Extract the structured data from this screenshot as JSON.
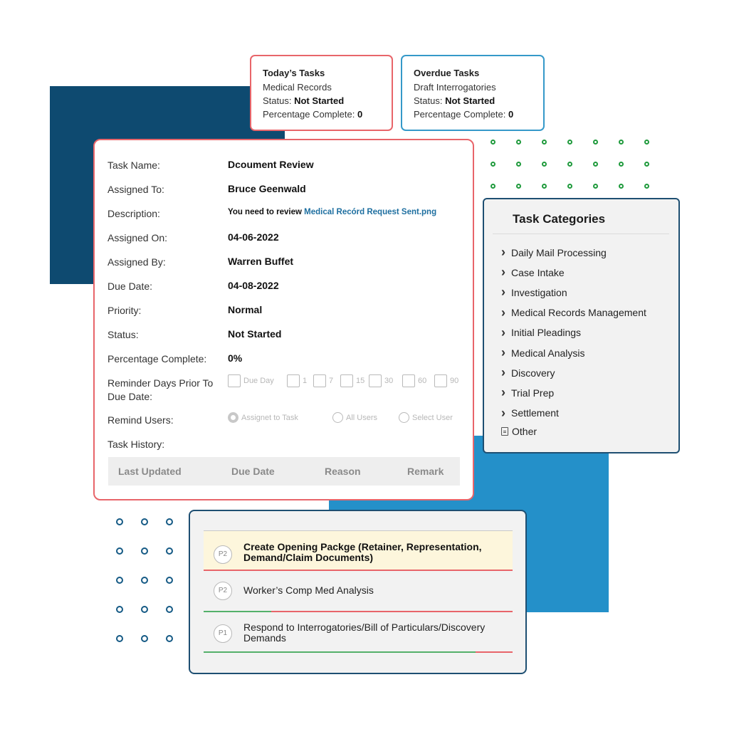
{
  "today": {
    "title": "Today’s Tasks",
    "task": "Medical Records",
    "status_label": "Status:",
    "status": "Not Started",
    "pct_label": "Percentage Complete:",
    "pct": "0"
  },
  "overdue": {
    "title": "Overdue Tasks",
    "task": "Draft Interrogatories",
    "status_label": "Status:",
    "status": "Not Started",
    "pct_label": "Percentage Complete:",
    "pct": "0"
  },
  "detail": {
    "task_name_label": "Task Name:",
    "task_name": "Dcoument Review",
    "assigned_to_label": "Assigned To:",
    "assigned_to": "Bruce Geenwald",
    "description_label": "Description:",
    "description_text": "You need to review",
    "description_link": "Medical Recórd Request Sent.png",
    "assigned_on_label": "Assigned On:",
    "assigned_on": "04-06-2022",
    "assigned_by_label": "Assigned By:",
    "assigned_by": "Warren Buffet",
    "due_date_label": "Due Date:",
    "due_date": "04-08-2022",
    "priority_label": "Priority:",
    "priority": "Normal",
    "status_label": "Status:",
    "status": "Not Started",
    "pct_label": "Percentage Complete:",
    "pct": "0%",
    "reminder_label": "Reminder Days Prior To Due Date:",
    "reminder_options": [
      "Due Day",
      "1",
      "7",
      "15",
      "30",
      "60",
      "90"
    ],
    "remind_users_label": "Remind Users:",
    "remind_options": [
      "Assignet to Task",
      "All Users",
      "Select User"
    ],
    "history_label": "Task History:",
    "history_headers": [
      "Last Updated",
      "Due Date",
      "Reason",
      "Remark"
    ]
  },
  "categories": {
    "title": "Task Categories",
    "items": [
      "Daily Mail Processing",
      "Case Intake",
      "Investigation",
      "Medical Records Management",
      "Initial Pleadings",
      "Medical Analysis",
      "Discovery",
      "Trial Prep",
      "Settlement",
      "Other"
    ]
  },
  "tasks": [
    {
      "priority": "P2",
      "text": "Create Opening Packge (Retainer, Representation, Demand/Claim Documents)",
      "progress": 0
    },
    {
      "priority": "P2",
      "text": "Worker’s Comp Med Analysis",
      "progress": 0.22
    },
    {
      "priority": "P1",
      "text": "Respond to Interrogatories/Bill of Particulars/Discovery Demands",
      "progress": 0.88
    }
  ],
  "colors": {
    "dark_blue": "#0e4a70",
    "light_blue": "#2490c9",
    "red": "#e8656a",
    "green": "#1f9a3c",
    "highlight": "#fdf6dc"
  }
}
